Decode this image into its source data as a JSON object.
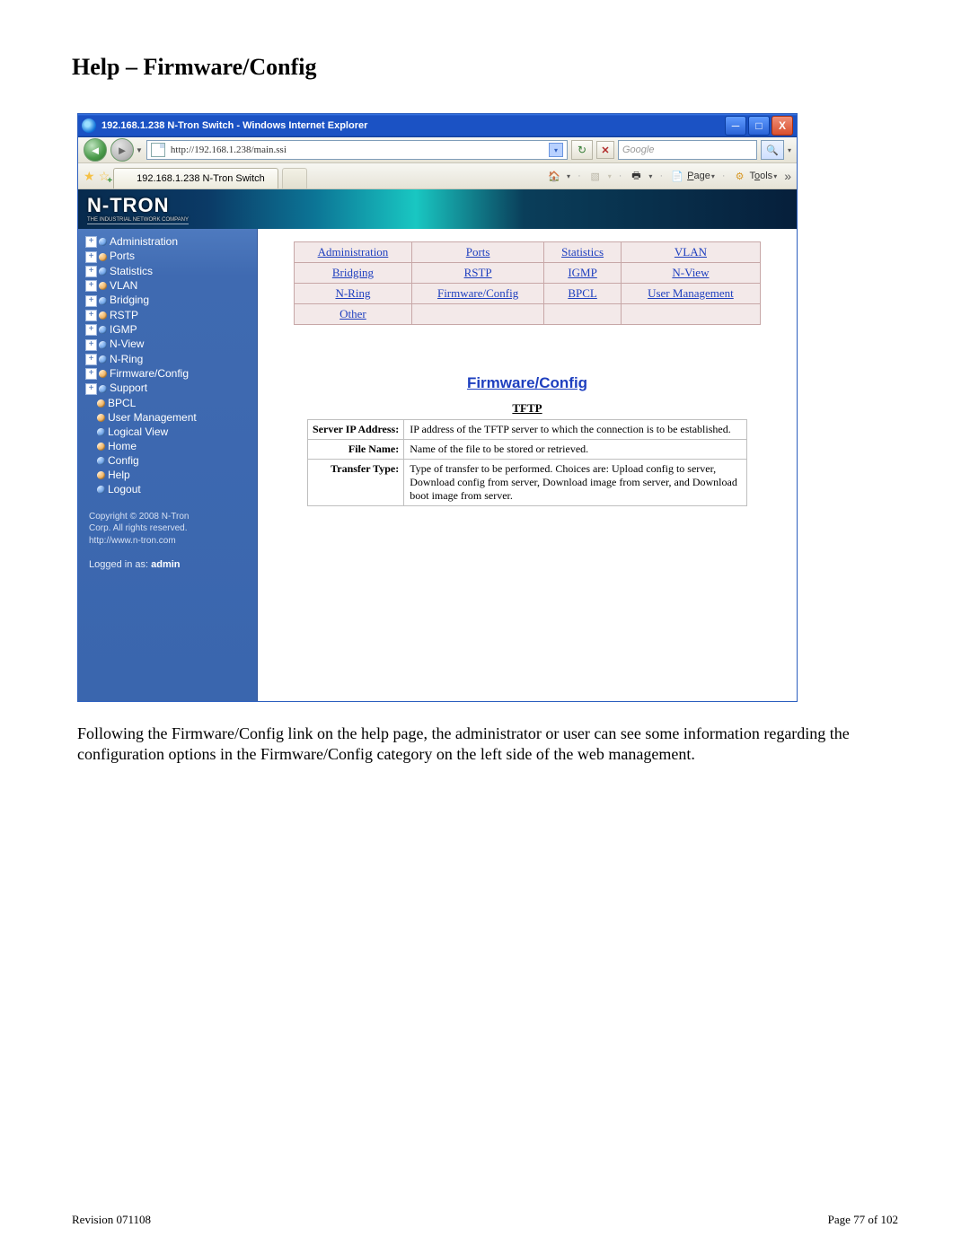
{
  "doc": {
    "heading": "Help – Firmware/Config",
    "paragraph": "Following the Firmware/Config link on the help page, the administrator or user can see some information regarding the configuration options in the Firmware/Config category on the left side of the web management.",
    "revision": "Revision 071108",
    "page": "Page 77 of 102"
  },
  "titlebar": {
    "text": "192.168.1.238 N-Tron Switch - Windows Internet Explorer"
  },
  "address": {
    "url": "http://192.168.1.238/main.ssi"
  },
  "search": {
    "placeholder": "Google"
  },
  "tab": {
    "label": "192.168.1.238 N-Tron Switch"
  },
  "toolbar": {
    "page": "Page",
    "tools": "Tools"
  },
  "logo": {
    "brand": "N-TRON",
    "tag": "THE INDUSTRIAL NETWORK COMPANY"
  },
  "sidebar": {
    "nodes": [
      {
        "exp": true,
        "color": "blue",
        "label": "Administration"
      },
      {
        "exp": true,
        "color": "orange",
        "label": "Ports"
      },
      {
        "exp": true,
        "color": "blue",
        "label": "Statistics"
      },
      {
        "exp": true,
        "color": "orange",
        "label": "VLAN"
      },
      {
        "exp": true,
        "color": "blue",
        "label": "Bridging"
      },
      {
        "exp": true,
        "color": "orange",
        "label": "RSTP"
      },
      {
        "exp": true,
        "color": "blue",
        "label": "IGMP"
      },
      {
        "exp": true,
        "color": "blue",
        "label": "N-View"
      },
      {
        "exp": true,
        "color": "blue",
        "label": "N-Ring"
      },
      {
        "exp": true,
        "color": "orange",
        "label": "Firmware/Config"
      },
      {
        "exp": true,
        "color": "blue",
        "label": "Support"
      },
      {
        "exp": false,
        "color": "orange",
        "label": "BPCL"
      },
      {
        "exp": false,
        "color": "orange",
        "label": "User Management"
      },
      {
        "exp": false,
        "color": "blue",
        "label": "Logical View"
      },
      {
        "exp": false,
        "color": "orange",
        "label": "Home"
      },
      {
        "exp": false,
        "color": "blue",
        "label": "Config"
      },
      {
        "exp": false,
        "color": "orange",
        "label": "Help"
      },
      {
        "exp": false,
        "color": "blue",
        "label": "Logout"
      }
    ],
    "copyright1": "Copyright © 2008 N-Tron",
    "copyright2": "Corp. All rights reserved.",
    "site": "http://www.n-tron.com",
    "login_prefix": "Logged in as: ",
    "login_user": "admin"
  },
  "links": {
    "r1": [
      "Administration",
      "Ports",
      "Statistics",
      "VLAN"
    ],
    "r2": [
      "Bridging",
      "RSTP",
      "IGMP",
      "N-View"
    ],
    "r3": [
      "N-Ring",
      "Firmware/Config",
      "BPCL",
      "User Management"
    ],
    "r4": [
      "Other",
      "",
      "",
      ""
    ]
  },
  "section": {
    "title": "Firmware/Config",
    "tftp": "TFTP"
  },
  "desc": {
    "rows": [
      {
        "k": "Server IP Address:",
        "v": "IP address of the TFTP server to which the connection is to be established."
      },
      {
        "k": "File Name:",
        "v": "Name of the file to be stored or retrieved."
      },
      {
        "k": "Transfer Type:",
        "v": "Type of transfer to be performed. Choices are: Upload config to server, Download config from server, Download image from server, and Download boot image from server."
      }
    ]
  }
}
